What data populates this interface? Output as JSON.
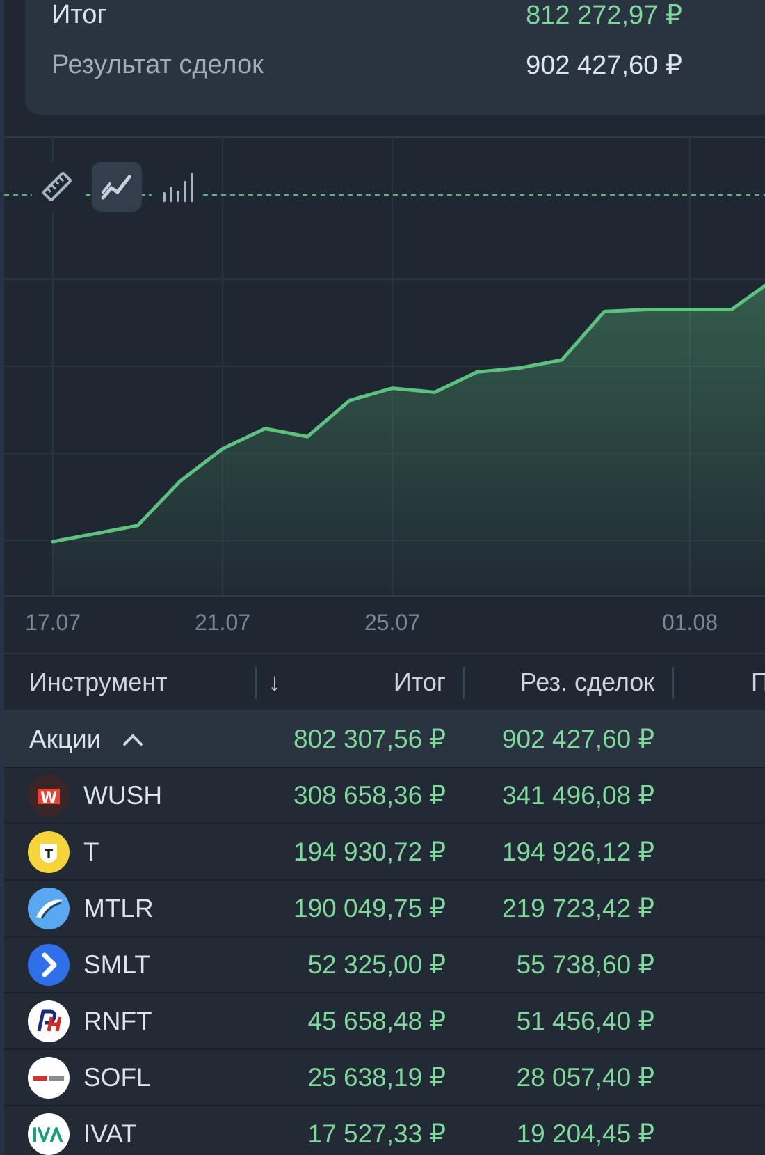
{
  "summary": {
    "total_label": "Итог",
    "total_value": "812 272,97 ₽",
    "result_label": "Результат сделок",
    "result_value": "902 427,60 ₽"
  },
  "chart_data": {
    "type": "area",
    "x_ticks": [
      "17.07",
      "21.07",
      "25.07",
      "01.08"
    ],
    "x": [
      "17.07",
      "18.07",
      "19.07",
      "20.07",
      "21.07",
      "22.07",
      "23.07",
      "24.07",
      "25.07",
      "26.07",
      "27.07",
      "28.07",
      "29.07",
      "30.07",
      "31.07",
      "01.08",
      "02.08",
      "03.08"
    ],
    "values": [
      0.1,
      0.12,
      0.14,
      0.25,
      0.33,
      0.38,
      0.36,
      0.45,
      0.48,
      0.47,
      0.52,
      0.53,
      0.55,
      0.67,
      0.675,
      0.675,
      0.675,
      0.75
    ],
    "y_unit": "relative",
    "grid": true,
    "baseline_dashed": true,
    "line_color": "#5cc27e",
    "baseline_color": "#55b877"
  },
  "chart_tools": [
    {
      "icon": "ruler-icon",
      "active": false
    },
    {
      "icon": "line-chart-icon",
      "active": true
    },
    {
      "icon": "bar-chart-icon",
      "active": false
    }
  ],
  "table": {
    "headers": {
      "instrument": "Инструмент",
      "sort_arrow": "↓",
      "total": "Итог",
      "result": "Рез. сделок",
      "next": "П"
    },
    "group": {
      "name": "Акции",
      "total": "802 307,56 ₽",
      "result": "902 427,60 ₽"
    },
    "rows": [
      {
        "ticker": "WUSH",
        "total": "308 658,36 ₽",
        "result": "341 496,08 ₽",
        "logo_color": "#3a2626",
        "icon": "wush-logo-icon"
      },
      {
        "ticker": "T",
        "total": "194 930,72 ₽",
        "result": "194 926,12 ₽",
        "logo_color": "#f5d33a",
        "icon": "tbank-logo-icon"
      },
      {
        "ticker": "MTLR",
        "total": "190 049,75 ₽",
        "result": "219 723,42 ₽",
        "logo_color": "#5aa9f0",
        "icon": "mechel-logo-icon"
      },
      {
        "ticker": "SMLT",
        "total": "52 325,00 ₽",
        "result": "55 738,60 ₽",
        "logo_color": "#2f6fe8",
        "icon": "samolet-logo-icon"
      },
      {
        "ticker": "RNFT",
        "total": "45 658,48 ₽",
        "result": "51 456,40 ₽",
        "logo_color": "#ffffff",
        "icon": "russneft-logo-icon"
      },
      {
        "ticker": "SOFL",
        "total": "25 638,19 ₽",
        "result": "28 057,40 ₽",
        "logo_color": "#ffffff",
        "icon": "softline-logo-icon"
      },
      {
        "ticker": "IVAT",
        "total": "17 527,33 ₽",
        "result": "19 204,45 ₽",
        "logo_color": "#ffffff",
        "icon": "iva-logo-icon"
      }
    ]
  }
}
